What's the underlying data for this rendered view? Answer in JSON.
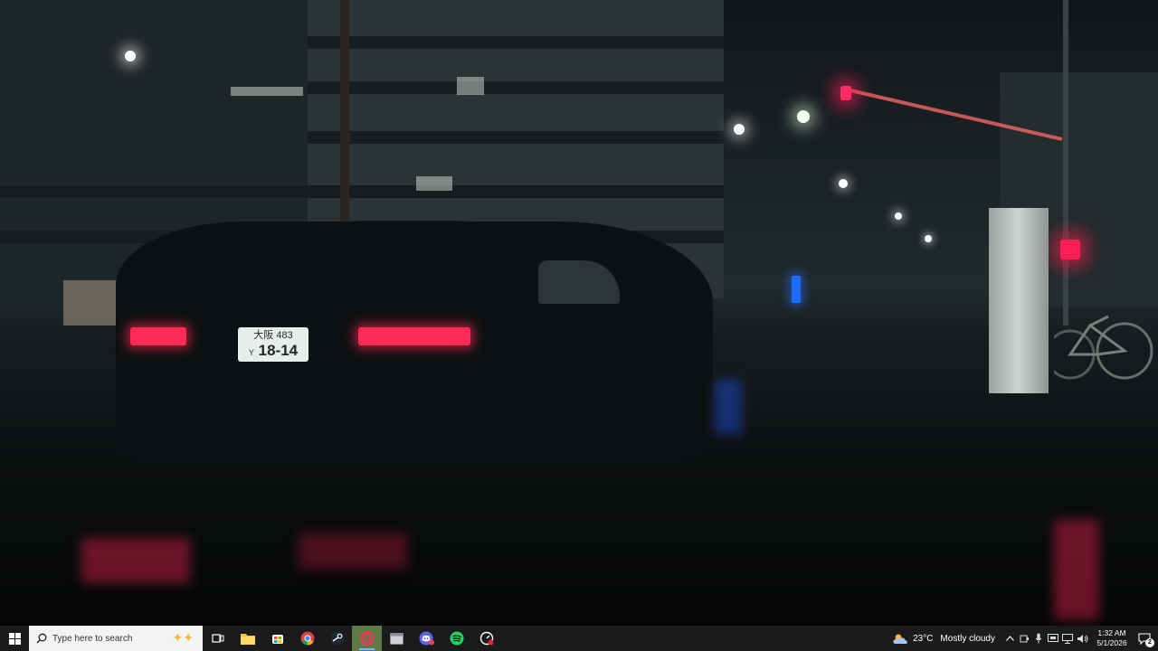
{
  "desktop": {
    "wallpaper": "night-city-rain-car",
    "plate": {
      "top": "大阪 483",
      "prefix": "Y",
      "number": "18-14"
    }
  },
  "taskbar": {
    "start_icon": "windows-logo-icon",
    "search": {
      "placeholder": "Type here to search"
    },
    "apps": [
      {
        "name": "task-view",
        "icon": "task-view-icon"
      },
      {
        "name": "file-explorer",
        "icon": "folder-icon"
      },
      {
        "name": "microsoft-store",
        "icon": "store-icon"
      },
      {
        "name": "chrome",
        "icon": "chrome-icon"
      },
      {
        "name": "steam",
        "icon": "steam-icon"
      },
      {
        "name": "opera-gx",
        "icon": "opera-gx-icon"
      },
      {
        "name": "app-window",
        "icon": "window-icon"
      },
      {
        "name": "discord",
        "icon": "discord-icon"
      },
      {
        "name": "spotify",
        "icon": "spotify-icon"
      },
      {
        "name": "monitor-app",
        "icon": "gauge-icon"
      }
    ],
    "weather": {
      "temp": "23°C",
      "desc": "Mostly cloudy"
    },
    "clock": {
      "time": "1:32 AM",
      "date": "5/1/2026"
    },
    "notifications": {
      "count": "2"
    },
    "colors": {
      "taskbar": "#1b1b1d",
      "accent": "#7fb2ff",
      "highlight": "#5e7a47"
    }
  }
}
